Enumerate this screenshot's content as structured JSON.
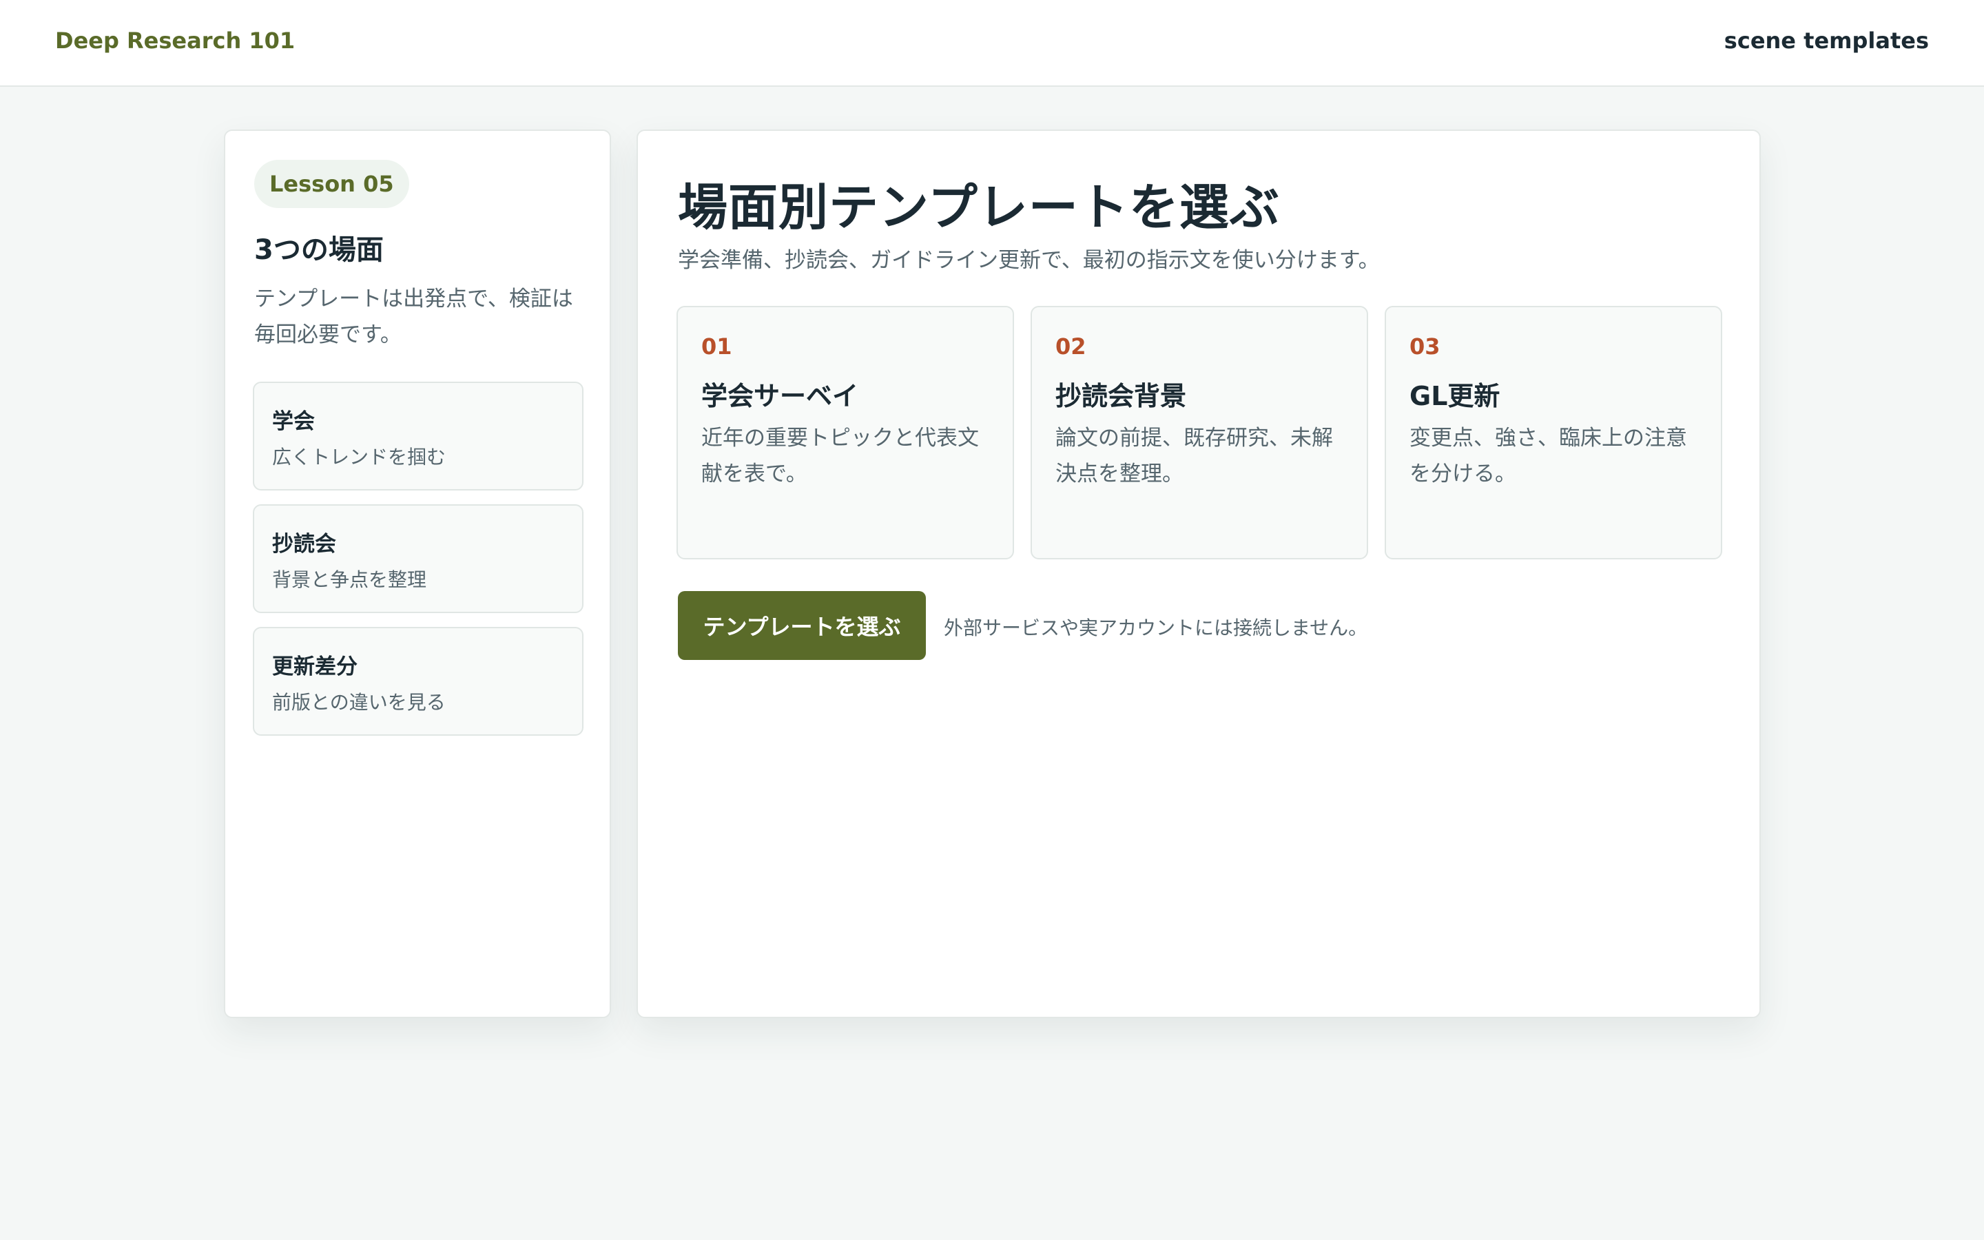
{
  "header": {
    "brand": "Deep Research 101",
    "nav_link": "scene templates"
  },
  "sidebar": {
    "badge": "Lesson 05",
    "title": "3つの場面",
    "description": "テンプレートは出発点で、検証は毎回必要です。",
    "items": [
      {
        "name": "学会",
        "sub": "広くトレンドを掴む"
      },
      {
        "name": "抄読会",
        "sub": "背景と争点を整理"
      },
      {
        "name": "更新差分",
        "sub": "前版との違いを見る"
      }
    ]
  },
  "main": {
    "title": "場面別テンプレートを選ぶ",
    "lead": "学会準備、抄読会、ガイドライン更新で、最初の指示文を使い分けます。",
    "cards": [
      {
        "num": "01",
        "title": "学会サーベイ",
        "desc": "近年の重要トピックと代表文献を表で。"
      },
      {
        "num": "02",
        "title": "抄読会背景",
        "desc": "論文の前提、既存研究、未解決点を整理。"
      },
      {
        "num": "03",
        "title": "GL更新",
        "desc": "変更点、強さ、臨床上の注意を分ける。"
      }
    ],
    "cta_label": "テンプレートを選ぶ",
    "cta_note": "外部サービスや実アカウントには接続しません。"
  },
  "colors": {
    "accent": "#5a6b29",
    "number": "#b8502a",
    "background": "#f4f7f6"
  }
}
